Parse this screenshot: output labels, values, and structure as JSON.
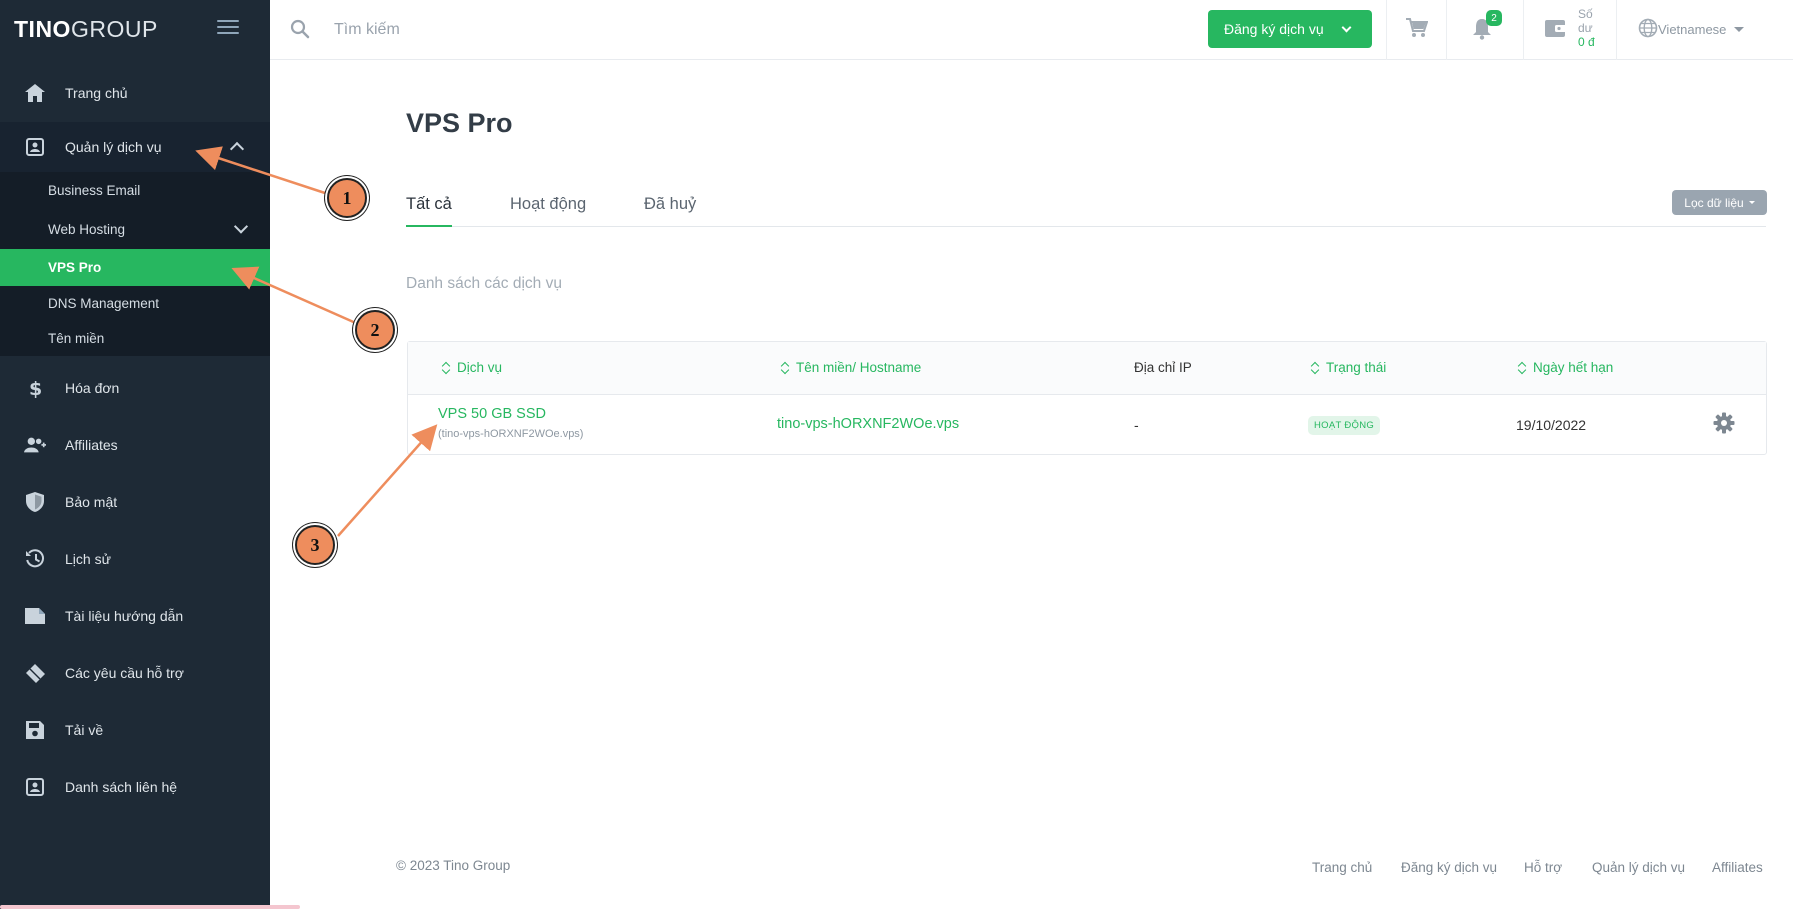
{
  "brand": {
    "logo_bold": "TINO",
    "logo_thin": "GROUP"
  },
  "search": {
    "placeholder": "Tìm kiếm"
  },
  "header": {
    "register_label": "Đăng ký dịch vụ",
    "notification_count": "2",
    "balance_label_1": "Số",
    "balance_label_2": "dư",
    "balance_amount": "0 đ",
    "language": "Vietnamese"
  },
  "sidebar": {
    "items": [
      {
        "label": "Trang chủ",
        "icon": "home-icon"
      },
      {
        "label": "Quản lý dịch vụ",
        "icon": "service-box-icon"
      },
      {
        "label": "Hóa đơn",
        "icon": "dollar-icon"
      },
      {
        "label": "Affiliates",
        "icon": "users-icon"
      },
      {
        "label": "Bảo mật",
        "icon": "shield-icon"
      },
      {
        "label": "Lịch sử",
        "icon": "history-icon"
      },
      {
        "label": "Tài liệu hướng dẫn",
        "icon": "document-icon"
      },
      {
        "label": "Các yêu cầu hỗ trợ",
        "icon": "ticket-icon"
      },
      {
        "label": "Tải về",
        "icon": "save-icon"
      },
      {
        "label": "Danh sách liên hệ",
        "icon": "contact-icon"
      }
    ],
    "sub_items": [
      {
        "label": "Business Email"
      },
      {
        "label": "Web Hosting"
      },
      {
        "label": "VPS Pro"
      },
      {
        "label": "DNS Management"
      },
      {
        "label": "Tên miền"
      }
    ]
  },
  "main": {
    "title": "VPS Pro",
    "tabs": [
      {
        "label": "Tất cả"
      },
      {
        "label": "Hoạt động"
      },
      {
        "label": "Đã huỷ"
      }
    ],
    "filter_label": "Lọc dữ liệu",
    "list_title": "Danh sách các dịch vụ",
    "table": {
      "headers": [
        "Dịch vụ",
        "Tên miền/ Hostname",
        "Địa chỉ IP",
        "Trạng thái",
        "Ngày hết hạn"
      ],
      "rows": [
        {
          "service": "VPS 50 GB SSD",
          "service_sub": "(tino-vps-hORXNF2WOe.vps)",
          "hostname": "tino-vps-hORXNF2WOe.vps",
          "ip": "-",
          "status": "HOẠT ĐỘNG",
          "expiry": "19/10/2022"
        }
      ]
    }
  },
  "footer": {
    "copyright": "© 2023 Tino Group",
    "links": [
      "Trang chủ",
      "Đăng ký dịch vụ",
      "Hỗ trợ",
      "Quản lý dịch vụ",
      "Affiliates"
    ]
  },
  "annotations": [
    "1",
    "2",
    "3"
  ],
  "colors": {
    "accent": "#27b760",
    "sidebar": "#1e2a36",
    "annotation": "#ee8d5d"
  }
}
